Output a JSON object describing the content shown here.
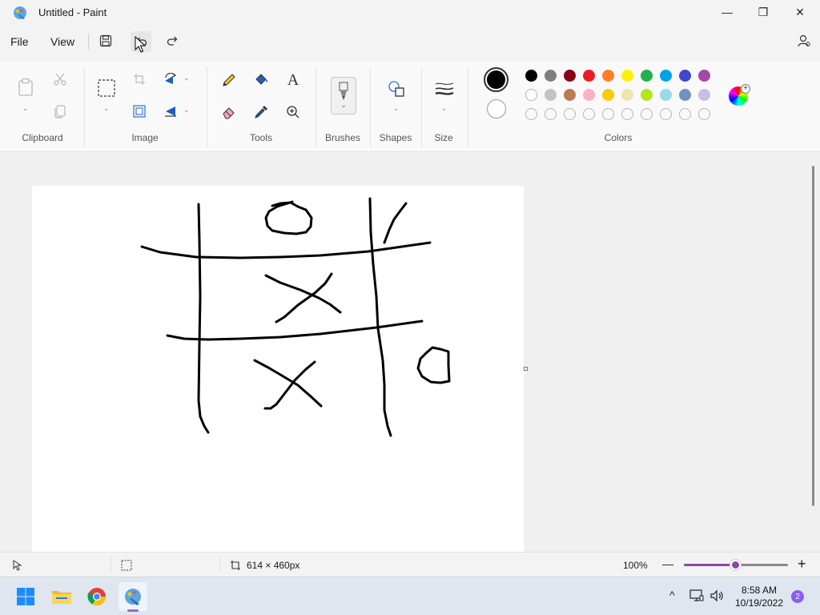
{
  "window": {
    "title": "Untitled - Paint",
    "minimize_glyph": "—",
    "maximize_glyph": "❐",
    "close_glyph": "✕"
  },
  "menu": {
    "file": "File",
    "view": "View"
  },
  "ribbon": {
    "groups": {
      "clipboard": "Clipboard",
      "image": "Image",
      "tools": "Tools",
      "brushes": "Brushes",
      "shapes": "Shapes",
      "size": "Size",
      "colors": "Colors"
    },
    "text_tool_glyph": "A",
    "primary_color": "#000000",
    "secondary_color": "#ffffff",
    "palette_row1": [
      "#000000",
      "#7f7f7f",
      "#880015",
      "#ed1c24",
      "#ff7f27",
      "#fff200",
      "#22b14c",
      "#00a2e8",
      "#3f48cc",
      "#a349a4"
    ],
    "palette_row2": [
      "#ffffff",
      "#c3c3c3",
      "#b97a57",
      "#ffaec9",
      "#ffc90e",
      "#efe4b0",
      "#b5e61d",
      "#99d9ea",
      "#7092be",
      "#c8bfe7"
    ]
  },
  "status": {
    "canvas_size": "614 × 460px",
    "zoom": "100%",
    "zoom_level": 0.5,
    "zoom_out_glyph": "—",
    "zoom_in_glyph": "+"
  },
  "taskbar": {
    "time": "8:58 AM",
    "date": "10/19/2022",
    "notifications": "2",
    "chevron_glyph": "^"
  }
}
